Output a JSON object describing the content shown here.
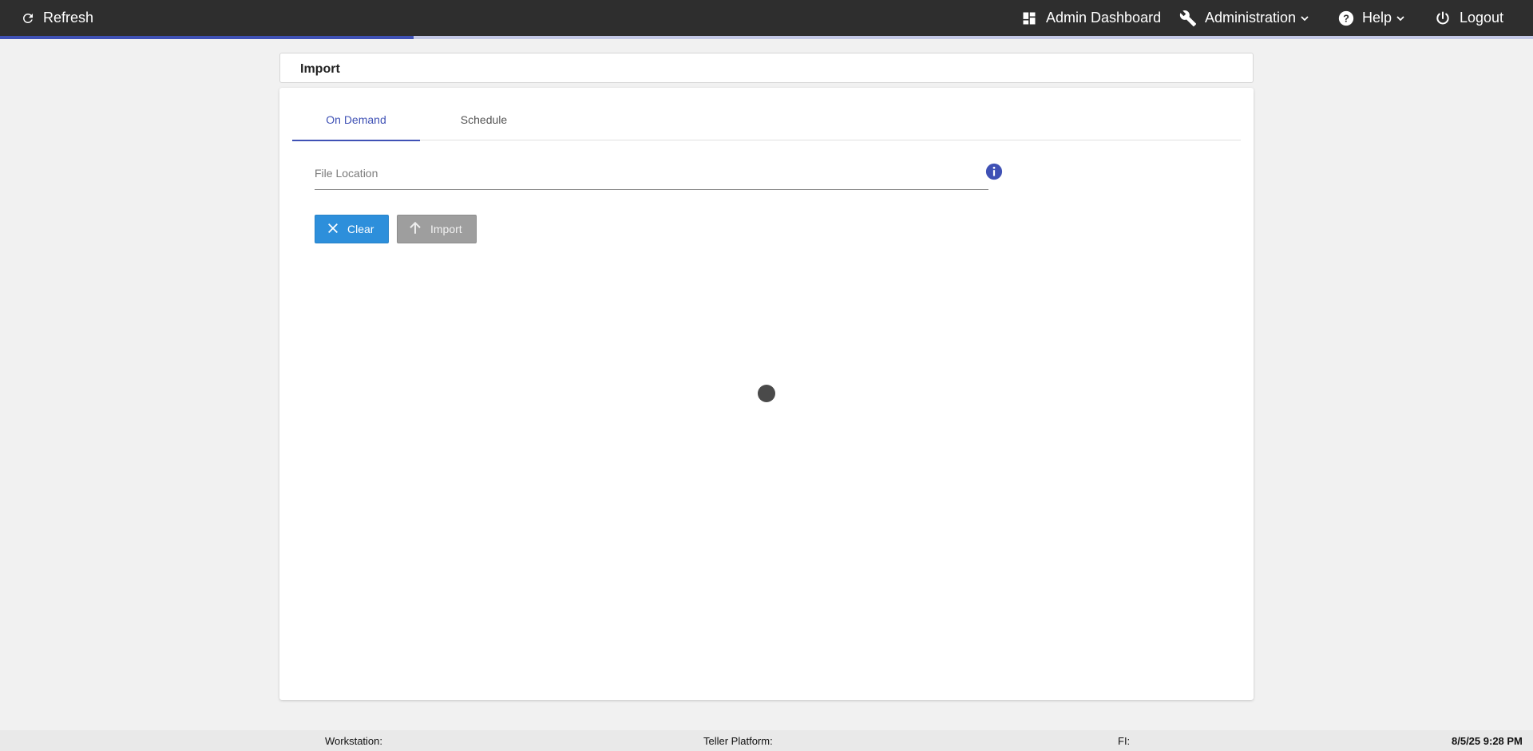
{
  "topbar": {
    "refresh_label": "Refresh",
    "admin_dashboard_label": "Admin Dashboard",
    "administration_label": "Administration",
    "help_label": "Help",
    "logout_label": "Logout"
  },
  "progress": {
    "fraction": 0.27
  },
  "page": {
    "title": "Import"
  },
  "tabs": [
    {
      "label": "On Demand",
      "active": true
    },
    {
      "label": "Schedule",
      "active": false
    }
  ],
  "file_location": {
    "placeholder": "File Location",
    "value": ""
  },
  "buttons": {
    "clear_label": "Clear",
    "import_label": "Import"
  },
  "footer": {
    "workstation_label": "Workstation:",
    "teller_platform_label": "Teller Platform:",
    "fi_label": "FI:",
    "timestamp": "8/5/25 9:28 PM"
  },
  "colors": {
    "accent": "#3f51b5",
    "topbar": "#2e2e2e",
    "clear_button": "#2d8fdb",
    "import_button_disabled": "#9e9e9e"
  }
}
